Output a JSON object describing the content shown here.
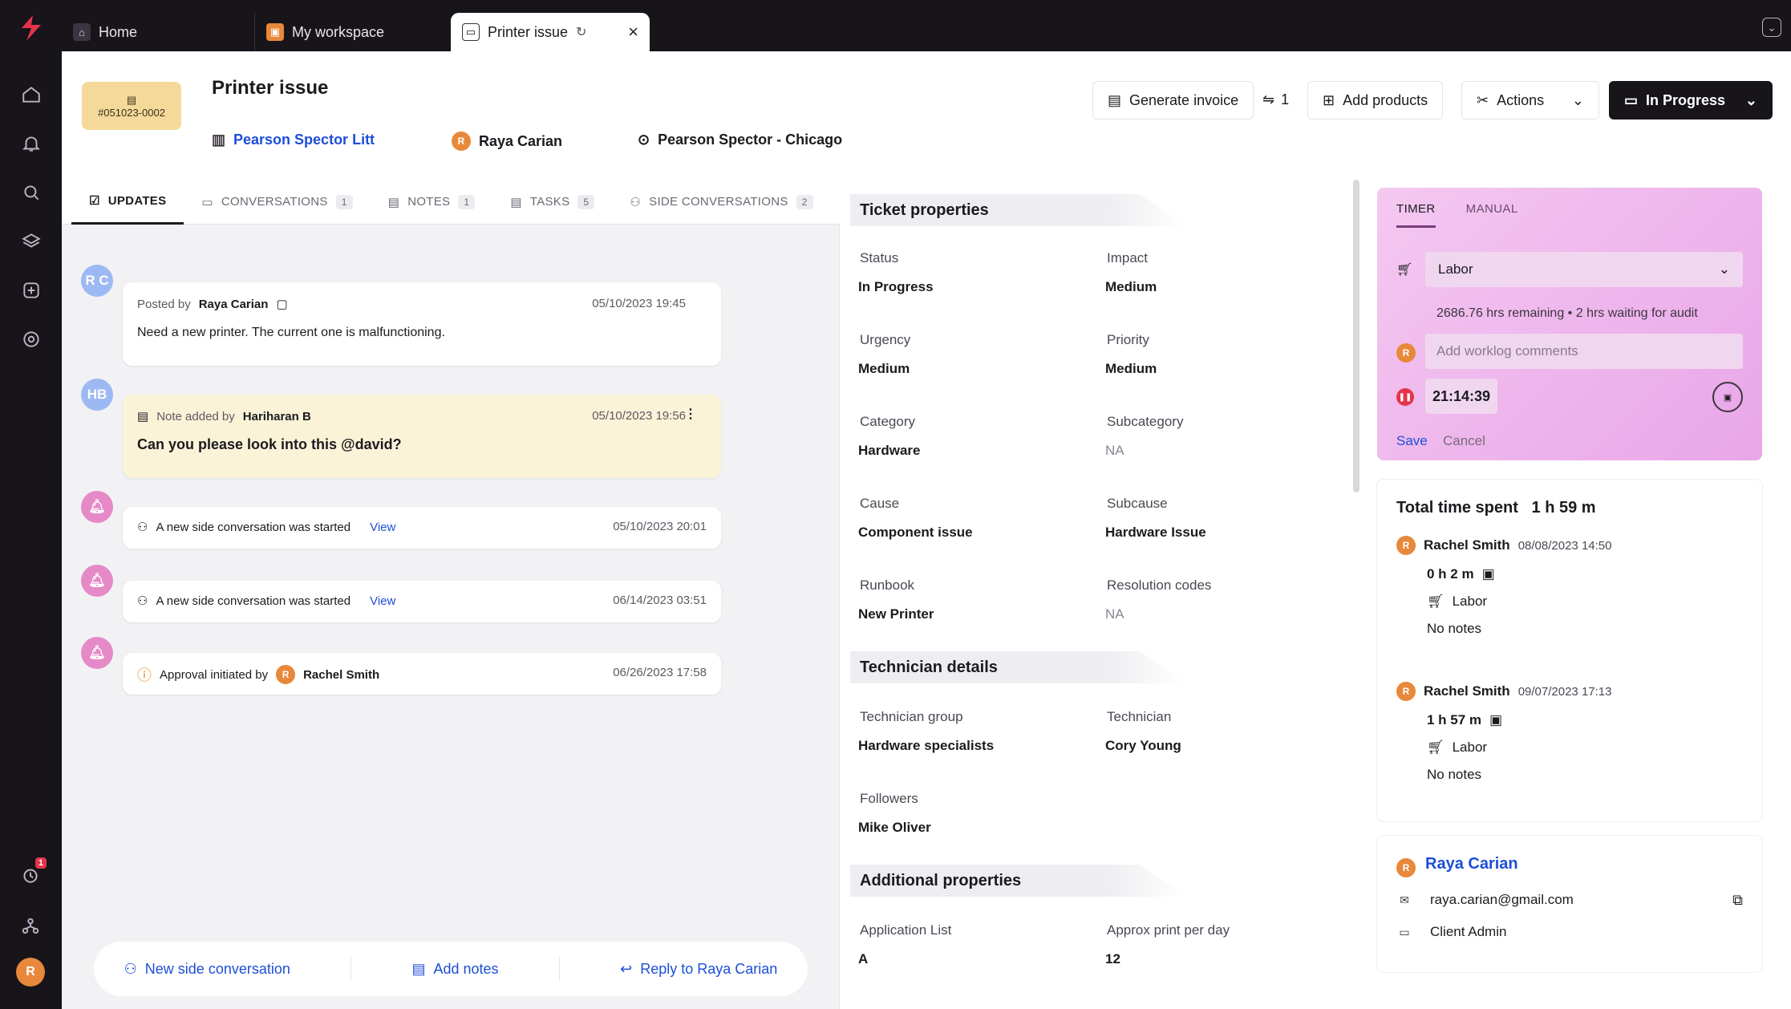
{
  "tabs": [
    {
      "label": "Home"
    },
    {
      "label": "My workspace"
    },
    {
      "label": "Printer issue"
    }
  ],
  "sidebar": {
    "notification_badge": "1",
    "user_initial": "R"
  },
  "ticket": {
    "id": "#051023-0002",
    "title": "Printer issue",
    "company": "Pearson Spector Litt",
    "requester": "Raya Carian",
    "requester_initial": "R",
    "location": "Pearson Spector - Chicago"
  },
  "header_actions": {
    "generate_invoice": "Generate invoice",
    "link_count": "1",
    "add_products": "Add products",
    "actions": "Actions",
    "status": "In Progress"
  },
  "subtabs": [
    {
      "label": "UPDATES",
      "count": ""
    },
    {
      "label": "CONVERSATIONS",
      "count": "1"
    },
    {
      "label": "NOTES",
      "count": "1"
    },
    {
      "label": "TASKS",
      "count": "5"
    },
    {
      "label": "SIDE CONVERSATIONS",
      "count": "2"
    }
  ],
  "feed": {
    "post": {
      "avatar": "R C",
      "prefix": "Posted by",
      "author": "Raya Carian",
      "date": "05/10/2023 19:45",
      "body": "Need a new printer. The current one is malfunctioning."
    },
    "note": {
      "avatar": "HB",
      "prefix": "Note added by",
      "author": "Hariharan B",
      "date": "05/10/2023 19:56",
      "body": "Can you please look into this @david?"
    },
    "side1": {
      "text": "A new side conversation was started",
      "link": "View",
      "date": "05/10/2023 20:01"
    },
    "side2": {
      "text": "A new side conversation was started",
      "link": "View",
      "date": "06/14/2023 03:51"
    },
    "approval": {
      "text": "Approval initiated by",
      "author": "Rachel Smith",
      "initial": "R",
      "date": "06/26/2023 17:58"
    }
  },
  "bottom_actions": {
    "new_side": "New side conversation",
    "add_notes": "Add notes",
    "reply": "Reply to Raya Carian"
  },
  "properties": {
    "ticket_heading": "Ticket properties",
    "status_l": "Status",
    "status_v": "In Progress",
    "impact_l": "Impact",
    "impact_v": "Medium",
    "urgency_l": "Urgency",
    "urgency_v": "Medium",
    "priority_l": "Priority",
    "priority_v": "Medium",
    "category_l": "Category",
    "category_v": "Hardware",
    "subcategory_l": "Subcategory",
    "subcategory_v": "NA",
    "cause_l": "Cause",
    "cause_v": "Component issue",
    "subcause_l": "Subcause",
    "subcause_v": "Hardware Issue",
    "runbook_l": "Runbook",
    "runbook_v": "New Printer",
    "resolution_l": "Resolution codes",
    "resolution_v": "NA",
    "tech_heading": "Technician details",
    "techgroup_l": "Technician group",
    "techgroup_v": "Hardware specialists",
    "tech_l": "Technician",
    "tech_v": "Cory Young",
    "followers_l": "Followers",
    "followers_v": "Mike Oliver",
    "additional_heading": "Additional properties",
    "applist_l": "Application List",
    "applist_v": "A",
    "approx_l": "Approx print per day",
    "approx_v": "12"
  },
  "timer": {
    "tab_timer": "TIMER",
    "tab_manual": "MANUAL",
    "worktype": "Labor",
    "remaining": "2686.76 hrs remaining",
    "waiting": "2 hrs waiting for audit",
    "comment_placeholder": "Add worklog comments",
    "clock": "21:14:39",
    "save": "Save",
    "cancel": "Cancel"
  },
  "time_spent": {
    "label": "Total time spent",
    "value": "1 h 59 m",
    "entries": [
      {
        "initial": "R",
        "name": "Rachel Smith",
        "date": "08/08/2023 14:50",
        "duration": "0 h 2 m",
        "type": "Labor",
        "notes": "No notes"
      },
      {
        "initial": "R",
        "name": "Rachel Smith",
        "date": "09/07/2023 17:13",
        "duration": "1 h 57 m",
        "type": "Labor",
        "notes": "No notes"
      }
    ]
  },
  "contact": {
    "initial": "R",
    "name": "Raya Carian",
    "email": "raya.carian@gmail.com",
    "role": "Client Admin"
  },
  "colors": {
    "accent": "#1d4ed8",
    "sidebar": "#17141a",
    "timer": "#e9a6e8",
    "note": "#fbf3d8",
    "chip": "#f5d99a"
  }
}
